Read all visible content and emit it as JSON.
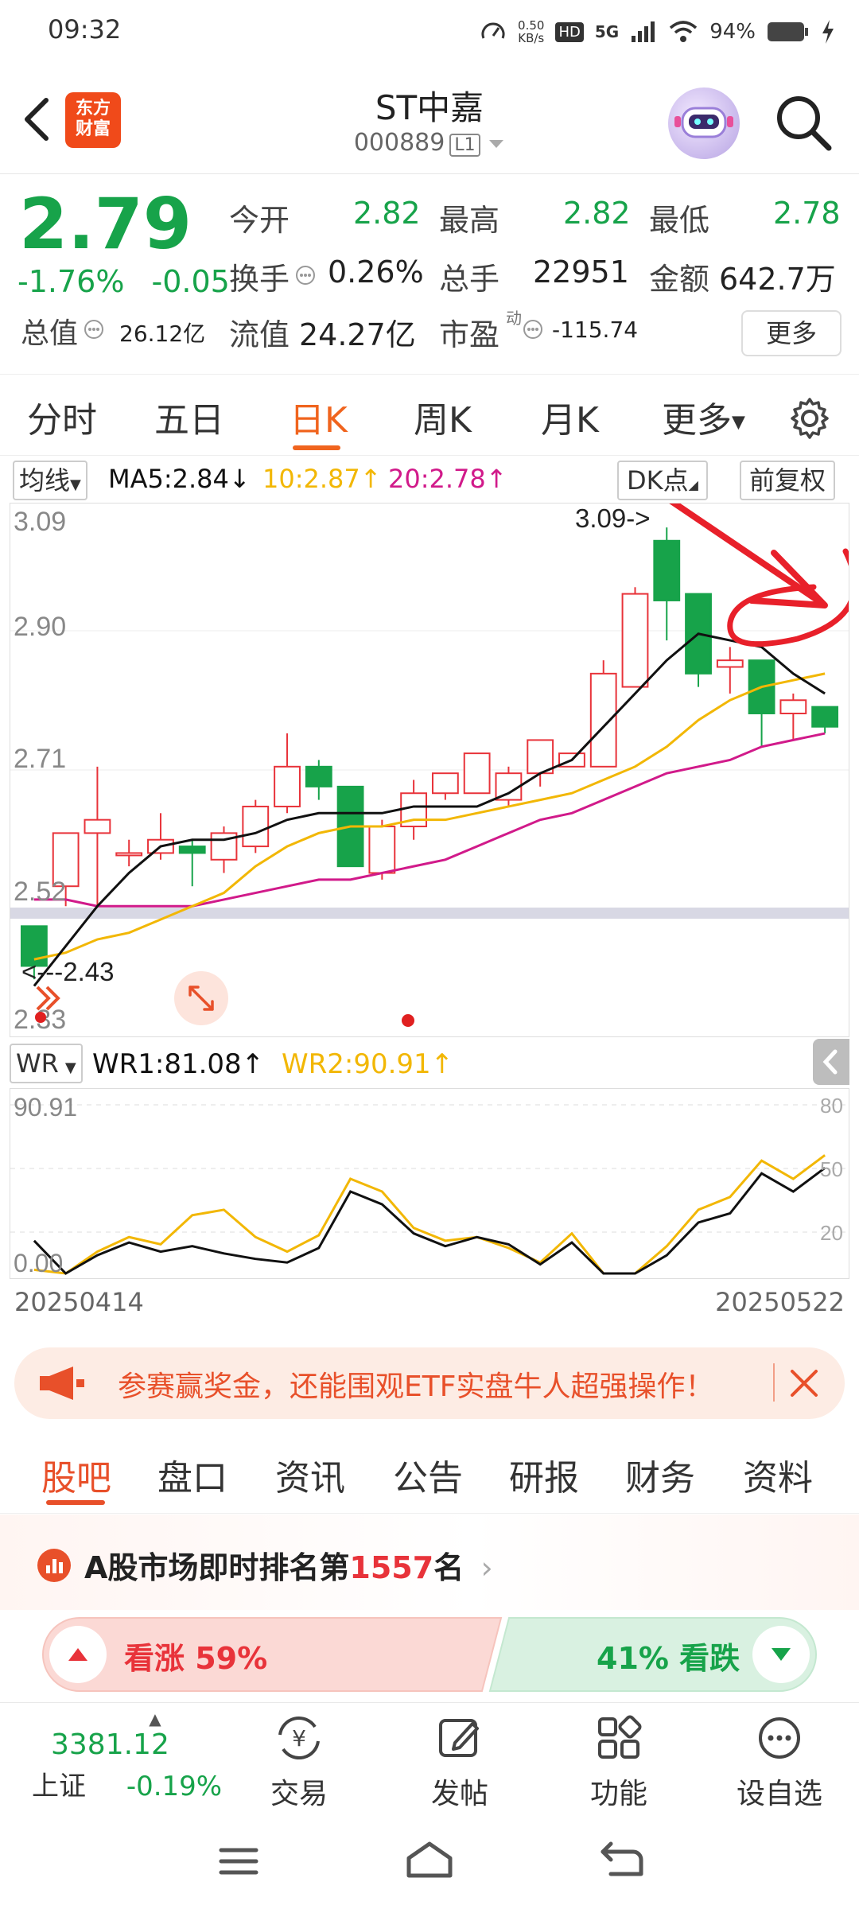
{
  "status": {
    "time": "09:32",
    "speed_value": "0.50",
    "speed_unit": "KB/s",
    "hd": "HD",
    "network": "5G",
    "battery": "94%"
  },
  "header": {
    "logo_line1": "东方",
    "logo_line2": "财富",
    "title": "ST中嘉",
    "code": "000889",
    "level": "L1"
  },
  "quote": {
    "price": "2.79",
    "change_pct": "-1.76%",
    "change": "-0.05",
    "open_label": "今开",
    "open": "2.82",
    "high_label": "最高",
    "high": "2.82",
    "low_label": "最低",
    "low": "2.78",
    "turnover_label": "换手",
    "turnover": "0.26%",
    "volume_label": "总手",
    "volume": "22951",
    "amount_label": "金额",
    "amount": "642.7万",
    "mcap_label": "总值",
    "mcap": "26.12亿",
    "float_label": "流值",
    "float_cap": "24.27亿",
    "pe_label": "市盈",
    "pe_sup": "动",
    "pe": "-115.74",
    "more": "更多"
  },
  "tabs": [
    "分时",
    "五日",
    "日K",
    "周K",
    "月K",
    "更多"
  ],
  "ma": {
    "selector": "均线",
    "ma5": "MA5:2.84",
    "ma10": "10:2.87",
    "ma20": "20:2.78",
    "dk": "DK点",
    "adjust": "前复权"
  },
  "colors": {
    "up": "#e8333a",
    "down": "#17a34a",
    "ma5": "#111111",
    "ma10": "#f2b705",
    "ma20": "#d11a8a",
    "accent": "#f0641e"
  },
  "chart_data": {
    "type": "candlestick",
    "y_ticks": [
      "3.09",
      "2.90",
      "2.71",
      "2.52",
      "2.33"
    ],
    "ylim": [
      2.33,
      3.12
    ],
    "annotations": {
      "high": "3.09->",
      "low": "<---2.43"
    },
    "x_start": "20250414",
    "x_end": "20250522",
    "candles": [
      {
        "o": 2.49,
        "c": 2.43,
        "h": 2.49,
        "l": 2.41
      },
      {
        "o": 2.55,
        "c": 2.63,
        "h": 2.63,
        "l": 2.52
      },
      {
        "o": 2.63,
        "c": 2.65,
        "h": 2.73,
        "l": 2.52
      },
      {
        "o": 2.6,
        "c": 2.6,
        "h": 2.62,
        "l": 2.58
      },
      {
        "o": 2.6,
        "c": 2.62,
        "h": 2.66,
        "l": 2.59
      },
      {
        "o": 2.61,
        "c": 2.6,
        "h": 2.62,
        "l": 2.55
      },
      {
        "o": 2.59,
        "c": 2.63,
        "h": 2.64,
        "l": 2.57
      },
      {
        "o": 2.61,
        "c": 2.67,
        "h": 2.68,
        "l": 2.6
      },
      {
        "o": 2.67,
        "c": 2.73,
        "h": 2.78,
        "l": 2.66
      },
      {
        "o": 2.73,
        "c": 2.7,
        "h": 2.74,
        "l": 2.68
      },
      {
        "o": 2.7,
        "c": 2.58,
        "h": 2.7,
        "l": 2.58
      },
      {
        "o": 2.57,
        "c": 2.64,
        "h": 2.65,
        "l": 2.56
      },
      {
        "o": 2.64,
        "c": 2.69,
        "h": 2.71,
        "l": 2.62
      },
      {
        "o": 2.69,
        "c": 2.72,
        "h": 2.72,
        "l": 2.68
      },
      {
        "o": 2.69,
        "c": 2.75,
        "h": 2.75,
        "l": 2.69
      },
      {
        "o": 2.68,
        "c": 2.72,
        "h": 2.73,
        "l": 2.67
      },
      {
        "o": 2.72,
        "c": 2.77,
        "h": 2.77,
        "l": 2.7
      },
      {
        "o": 2.73,
        "c": 2.75,
        "h": 2.75,
        "l": 2.73
      },
      {
        "o": 2.73,
        "c": 2.87,
        "h": 2.89,
        "l": 2.73
      },
      {
        "o": 2.85,
        "c": 2.99,
        "h": 3.0,
        "l": 2.85
      },
      {
        "o": 3.07,
        "c": 2.98,
        "h": 3.09,
        "l": 2.92
      },
      {
        "o": 2.99,
        "c": 2.87,
        "h": 2.99,
        "l": 2.85
      },
      {
        "o": 2.88,
        "c": 2.89,
        "h": 2.91,
        "l": 2.84
      },
      {
        "o": 2.89,
        "c": 2.81,
        "h": 2.89,
        "l": 2.76
      },
      {
        "o": 2.81,
        "c": 2.83,
        "h": 2.84,
        "l": 2.77
      },
      {
        "o": 2.82,
        "c": 2.79,
        "h": 2.82,
        "l": 2.78
      }
    ],
    "ma5": [
      2.4,
      2.46,
      2.52,
      2.57,
      2.61,
      2.62,
      2.62,
      2.63,
      2.65,
      2.66,
      2.66,
      2.66,
      2.67,
      2.67,
      2.67,
      2.69,
      2.72,
      2.74,
      2.79,
      2.84,
      2.89,
      2.93,
      2.92,
      2.91,
      2.87,
      2.84
    ],
    "ma10": [
      2.44,
      2.45,
      2.47,
      2.48,
      2.5,
      2.52,
      2.54,
      2.58,
      2.61,
      2.63,
      2.64,
      2.64,
      2.65,
      2.65,
      2.66,
      2.67,
      2.68,
      2.69,
      2.71,
      2.73,
      2.76,
      2.8,
      2.83,
      2.85,
      2.86,
      2.87
    ],
    "ma20": [
      2.53,
      2.53,
      2.52,
      2.52,
      2.52,
      2.52,
      2.53,
      2.54,
      2.55,
      2.56,
      2.56,
      2.57,
      2.58,
      2.59,
      2.61,
      2.63,
      2.65,
      2.66,
      2.68,
      2.7,
      2.72,
      2.73,
      2.74,
      2.76,
      2.77,
      2.78
    ]
  },
  "wr": {
    "selector": "WR",
    "wr1": "WR1:81.08",
    "wr2": "WR2:90.91",
    "top_label": "90.91",
    "bottom_label": "0.00",
    "right_ticks": [
      "80",
      "50",
      "20"
    ],
    "wr1_values": [
      18,
      0,
      10,
      17,
      12,
      15,
      11,
      8,
      6,
      14,
      45,
      38,
      22,
      15,
      20,
      16,
      5,
      17,
      0,
      0,
      10,
      28,
      33,
      55,
      45,
      58
    ],
    "wr2_values": [
      2,
      0,
      12,
      20,
      16,
      32,
      35,
      20,
      12,
      21,
      52,
      45,
      25,
      18,
      20,
      14,
      6,
      22,
      0,
      0,
      15,
      35,
      42,
      62,
      52,
      65
    ]
  },
  "banner": {
    "text": "参赛赢奖金，还能围观ETF实盘牛人超强操作！"
  },
  "bottom_tabs": [
    "股吧",
    "盘口",
    "资讯",
    "公告",
    "研报",
    "财务",
    "资料"
  ],
  "rank": {
    "prefix": "A股市场即时排名第",
    "value": "1557",
    "suffix": "名"
  },
  "vote": {
    "up_label": "看涨 59%",
    "down_label": "41% 看跌"
  },
  "bottom_bar": {
    "index_value": "3381.12",
    "index_name": "上证",
    "index_change": "-0.19%",
    "trade": "交易",
    "post": "发帖",
    "functions": "功能",
    "watch": "设自选"
  }
}
